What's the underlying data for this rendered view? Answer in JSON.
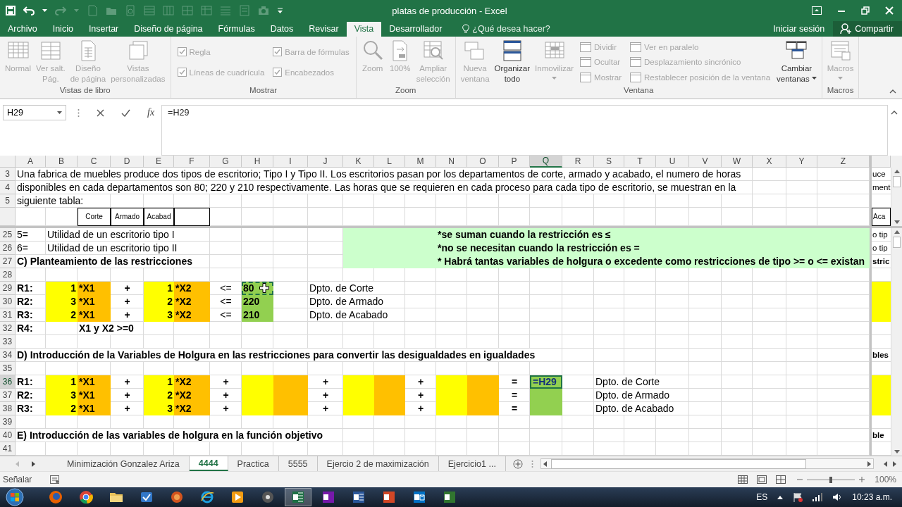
{
  "window": {
    "title": "platas de producción - Excel"
  },
  "ribbon_tabs": [
    {
      "label": "Archivo",
      "selected": false
    },
    {
      "label": "Inicio",
      "selected": false
    },
    {
      "label": "Insertar",
      "selected": false
    },
    {
      "label": "Diseño de página",
      "selected": false
    },
    {
      "label": "Fórmulas",
      "selected": false
    },
    {
      "label": "Datos",
      "selected": false
    },
    {
      "label": "Revisar",
      "selected": false
    },
    {
      "label": "Vista",
      "selected": true
    },
    {
      "label": "Desarrollador",
      "selected": false
    }
  ],
  "tell_me": {
    "placeholder": "¿Qué desea hacer?"
  },
  "account": {
    "sign_in": "Iniciar sesión",
    "share": "Compartir"
  },
  "ribbon_groups": [
    {
      "label": "Vistas de libro",
      "items": [
        {
          "kind": "large",
          "label": "Normal",
          "disabled": true,
          "dropdown": false
        },
        {
          "kind": "large",
          "label": "Ver salt.\nPág.",
          "disabled": true,
          "dropdown": false
        },
        {
          "kind": "large",
          "label": "Diseño\nde página",
          "disabled": true,
          "dropdown": false
        },
        {
          "kind": "large",
          "label": "Vistas\npersonalizadas",
          "disabled": true,
          "dropdown": false
        }
      ]
    },
    {
      "label": "Mostrar",
      "items": [
        {
          "kind": "check",
          "label": "Regla",
          "checked": true,
          "disabled": true
        },
        {
          "kind": "check",
          "label": "Líneas de cuadrícula",
          "checked": true,
          "disabled": true
        },
        {
          "kind": "check",
          "label": "Barra de fórmulas",
          "checked": true,
          "disabled": true
        },
        {
          "kind": "check",
          "label": "Encabezados",
          "checked": true,
          "disabled": true
        }
      ]
    },
    {
      "label": "Zoom",
      "items": [
        {
          "kind": "large",
          "label": "Zoom",
          "disabled": true,
          "dropdown": false
        },
        {
          "kind": "large",
          "label": "100%",
          "disabled": true,
          "dropdown": false
        },
        {
          "kind": "large",
          "label": "Ampliar\nselección",
          "disabled": true,
          "dropdown": false
        }
      ]
    },
    {
      "label": "Ventana",
      "items": [
        {
          "kind": "large",
          "label": "Nueva\nventana",
          "disabled": true,
          "dropdown": false
        },
        {
          "kind": "large",
          "label": "Organizar\ntodo",
          "disabled": false,
          "dropdown": false
        },
        {
          "kind": "large",
          "label": "Inmovilizar",
          "disabled": true,
          "dropdown": true
        },
        {
          "kind": "small",
          "label": "Dividir",
          "disabled": true
        },
        {
          "kind": "small",
          "label": "Ocultar",
          "disabled": true
        },
        {
          "kind": "small",
          "label": "Mostrar",
          "disabled": true
        },
        {
          "kind": "small",
          "label": "Ver en paralelo",
          "disabled": true
        },
        {
          "kind": "small",
          "label": "Desplazamiento sincrónico",
          "disabled": true
        },
        {
          "kind": "small",
          "label": "Restablecer posición de la ventana",
          "disabled": true
        },
        {
          "kind": "large",
          "label": "Cambiar\nventanas",
          "disabled": false,
          "dropdown": true
        }
      ]
    },
    {
      "label": "Macros",
      "items": [
        {
          "kind": "large",
          "label": "Macros",
          "disabled": true,
          "dropdown": true
        }
      ]
    }
  ],
  "formula_bar": {
    "name_box": "H29",
    "function_button": "fx",
    "formula": "=H29"
  },
  "sheet": {
    "columns": [
      {
        "label": "A",
        "selected": false
      },
      {
        "label": "B",
        "selected": false
      },
      {
        "label": "C",
        "selected": false
      },
      {
        "label": "D",
        "selected": false
      },
      {
        "label": "E",
        "selected": false
      },
      {
        "label": "F",
        "selected": false
      },
      {
        "label": "G",
        "selected": false
      },
      {
        "label": "H",
        "selected": false
      },
      {
        "label": "I",
        "selected": false
      },
      {
        "label": "J",
        "selected": false
      },
      {
        "label": "K",
        "selected": false
      },
      {
        "label": "L",
        "selected": false
      },
      {
        "label": "M",
        "selected": false
      },
      {
        "label": "N",
        "selected": false
      },
      {
        "label": "O",
        "selected": false
      },
      {
        "label": "P",
        "selected": false
      },
      {
        "label": "Q",
        "selected": true
      },
      {
        "label": "R",
        "selected": false
      },
      {
        "label": "S",
        "selected": false
      },
      {
        "label": "T",
        "selected": false
      },
      {
        "label": "U",
        "selected": false
      },
      {
        "label": "V",
        "selected": false
      },
      {
        "label": "W",
        "selected": false
      },
      {
        "label": "X",
        "selected": false
      },
      {
        "label": "Y",
        "selected": false
      },
      {
        "label": "Z",
        "selected": false
      }
    ],
    "top_rows": [
      {
        "number": "3",
        "kind": "normal",
        "selected": false,
        "cells": {
          "A": {
            "text": "Una fabrica de muebles produce dos tipos de escritorio; Tipo I y Tipo II. Los escritorios pasan por los departamentos de corte, armado y acabado, el numero de horas"
          },
          "pane": {
            "text": "uce"
          }
        }
      },
      {
        "number": "4",
        "kind": "normal",
        "selected": false,
        "cells": {
          "A": {
            "text": "disponibles en cada departamentos son 80; 220 y 210 respectivamente. Las horas que se requieren en cada proceso para cada tipo de escritorio, se muestran en la"
          },
          "pane": {
            "text": "ment"
          }
        }
      },
      {
        "number": "5",
        "kind": "normal",
        "selected": false,
        "cells": {
          "A": {
            "text": "siguiente tabla:"
          }
        }
      },
      {
        "kind": "small",
        "selected": false,
        "cells": {
          "C": {
            "text": "Corte",
            "centered": true,
            "border": true
          },
          "D": {
            "text": "Armado",
            "centered": true,
            "border": true
          },
          "E": {
            "text": "Acabad",
            "centered": true,
            "border": true
          },
          "F": {
            "border": true
          },
          "pane": {
            "text": "Aca",
            "border": true
          }
        }
      }
    ],
    "bottom_rows": [
      {
        "number": "25",
        "kind": "normal",
        "selected": false,
        "cells": {
          "A": {
            "text": "5="
          },
          "B": {
            "text": "Utilidad de un escritorio tipo I"
          },
          "K": {
            "color": "#ccffcc",
            "fill_to_end": true
          },
          "N": {
            "text": "*se suman cuando la restricción es ≤",
            "bold": true
          },
          "pane": {
            "text": "o tip"
          }
        }
      },
      {
        "number": "26",
        "kind": "normal",
        "selected": false,
        "cells": {
          "A": {
            "text": "6="
          },
          "B": {
            "text": "Utilidad de un escritorio tipo II"
          },
          "K": {
            "color": "#ccffcc",
            "fill_to_end": true
          },
          "N": {
            "text": "*no se necesitan cuando la restricción es =",
            "bold": true
          },
          "pane": {
            "text": "o tip"
          }
        }
      },
      {
        "number": "27",
        "kind": "normal",
        "selected": false,
        "cells": {
          "A": {
            "text": "C) Planteamiento de las restricciones",
            "bold": true
          },
          "K": {
            "color": "#ccffcc",
            "fill_to_end": true
          },
          "N": {
            "text": "* Habrá tantas variables de holgura o excedente como restricciones de tipo >= o <= existan",
            "bold": true
          },
          "pane": {
            "text": "stric",
            "bold": true
          }
        }
      },
      {
        "number": "28",
        "kind": "normal",
        "selected": false
      },
      {
        "number": "29",
        "kind": "normal",
        "selected": false,
        "cells": {
          "A": {
            "text": "R1:",
            "bold": true
          },
          "B": {
            "text": "1",
            "color": "#ffff00",
            "right_aligned": true,
            "bold": true
          },
          "C": {
            "text": "*X1",
            "color": "#ffc000",
            "bold": true
          },
          "D": {
            "text": "+",
            "centered": true,
            "bold": true
          },
          "E": {
            "text": "1",
            "color": "#ffff00",
            "right_aligned": true,
            "bold": true
          },
          "F": {
            "text": "*X2",
            "color": "#ffc000",
            "bold": true
          },
          "G": {
            "text": "<=",
            "centered": true
          },
          "H": {
            "text": "80",
            "color": "#92d050",
            "bold": true,
            "marquee": true,
            "mouse_cursor": true
          },
          "J": {
            "text": "Dpto. de Corte"
          },
          "pane": {
            "color": "#ffff00"
          }
        }
      },
      {
        "number": "30",
        "kind": "normal",
        "selected": false,
        "cells": {
          "A": {
            "text": "R2:",
            "bold": true
          },
          "B": {
            "text": "3",
            "color": "#ffff00",
            "right_aligned": true,
            "bold": true
          },
          "C": {
            "text": "*X1",
            "color": "#ffc000",
            "bold": true
          },
          "D": {
            "text": "+",
            "centered": true,
            "bold": true
          },
          "E": {
            "text": "2",
            "color": "#ffff00",
            "right_aligned": true,
            "bold": true
          },
          "F": {
            "text": "*X2",
            "color": "#ffc000",
            "bold": true
          },
          "G": {
            "text": "<=",
            "centered": true
          },
          "H": {
            "text": "220",
            "color": "#92d050",
            "bold": true
          },
          "J": {
            "text": "Dpto. de Armado"
          },
          "pane": {
            "color": "#ffff00"
          }
        }
      },
      {
        "number": "31",
        "kind": "normal",
        "selected": false,
        "cells": {
          "A": {
            "text": "R3:",
            "bold": true
          },
          "B": {
            "text": "2",
            "color": "#ffff00",
            "right_aligned": true,
            "bold": true
          },
          "C": {
            "text": "*X1",
            "color": "#ffc000",
            "bold": true
          },
          "D": {
            "text": "+",
            "centered": true,
            "bold": true
          },
          "E": {
            "text": "3",
            "color": "#ffff00",
            "right_aligned": true,
            "bold": true
          },
          "F": {
            "text": "*X2",
            "color": "#ffc000",
            "bold": true
          },
          "G": {
            "text": "<=",
            "centered": true
          },
          "H": {
            "text": "210",
            "color": "#92d050",
            "bold": true
          },
          "J": {
            "text": "Dpto. de Acabado"
          },
          "pane": {
            "color": "#ffff00"
          }
        }
      },
      {
        "number": "32",
        "kind": "normal",
        "selected": false,
        "cells": {
          "A": {
            "text": "R4:",
            "bold": true
          },
          "C": {
            "text": "X1 y X2 >=0",
            "bold": true
          }
        }
      },
      {
        "number": "33",
        "kind": "normal",
        "selected": false
      },
      {
        "number": "34",
        "kind": "normal",
        "selected": false,
        "cells": {
          "A": {
            "text": "D) Introducción de la Variables de Holgura en las restricciones  para convertir las desigualdades en igualdades",
            "bold": true
          },
          "pane": {
            "text": "bles",
            "bold": true
          }
        }
      },
      {
        "number": "35",
        "kind": "normal",
        "selected": false
      },
      {
        "number": "36",
        "kind": "normal",
        "selected": true,
        "cells": {
          "A": {
            "text": "R1:",
            "bold": true
          },
          "B": {
            "text": "1",
            "color": "#ffff00",
            "right_aligned": true,
            "bold": true
          },
          "C": {
            "text": "*X1",
            "color": "#ffc000",
            "bold": true
          },
          "D": {
            "text": "+",
            "centered": true,
            "bold": true
          },
          "E": {
            "text": "1",
            "color": "#ffff00",
            "right_aligned": true,
            "bold": true
          },
          "F": {
            "text": "*X2",
            "color": "#ffc000",
            "bold": true
          },
          "G": {
            "text": "+",
            "centered": true,
            "bold": true
          },
          "H": {
            "color": "#ffff00"
          },
          "I": {
            "color": "#ffc000"
          },
          "J": {
            "text": "+",
            "centered": true,
            "bold": true
          },
          "K": {
            "color": "#ffff00"
          },
          "L": {
            "color": "#ffc000"
          },
          "M": {
            "text": "+",
            "centered": true,
            "bold": true
          },
          "N": {
            "color": "#ffff00"
          },
          "O": {
            "color": "#ffc000"
          },
          "P": {
            "text": "=",
            "centered": true,
            "bold": true
          },
          "Q": {
            "text": "=H29",
            "color": "#92d050",
            "bold": true,
            "editing": true
          },
          "S": {
            "text": "Dpto. de Corte"
          },
          "pane": {
            "color": "#ffff00"
          }
        }
      },
      {
        "number": "37",
        "kind": "normal",
        "selected": false,
        "cells": {
          "A": {
            "text": "R2:",
            "bold": true
          },
          "B": {
            "text": "3",
            "color": "#ffff00",
            "right_aligned": true,
            "bold": true
          },
          "C": {
            "text": "*X1",
            "color": "#ffc000",
            "bold": true
          },
          "D": {
            "text": "+",
            "centered": true,
            "bold": true
          },
          "E": {
            "text": "2",
            "color": "#ffff00",
            "right_aligned": true,
            "bold": true
          },
          "F": {
            "text": "*X2",
            "color": "#ffc000",
            "bold": true
          },
          "G": {
            "text": "+",
            "centered": true,
            "bold": true
          },
          "H": {
            "color": "#ffff00"
          },
          "I": {
            "color": "#ffc000"
          },
          "J": {
            "text": "+",
            "centered": true,
            "bold": true
          },
          "K": {
            "color": "#ffff00"
          },
          "L": {
            "color": "#ffc000"
          },
          "M": {
            "text": "+",
            "centered": true,
            "bold": true
          },
          "N": {
            "color": "#ffff00"
          },
          "O": {
            "color": "#ffc000"
          },
          "P": {
            "text": "=",
            "centered": true,
            "bold": true
          },
          "Q": {
            "color": "#92d050"
          },
          "S": {
            "text": "Dpto. de Armado"
          },
          "pane": {
            "color": "#ffff00"
          }
        }
      },
      {
        "number": "38",
        "kind": "normal",
        "selected": false,
        "cells": {
          "A": {
            "text": "R3:",
            "bold": true
          },
          "B": {
            "text": "2",
            "color": "#ffff00",
            "right_aligned": true,
            "bold": true
          },
          "C": {
            "text": "*X1",
            "color": "#ffc000",
            "bold": true
          },
          "D": {
            "text": "+",
            "centered": true,
            "bold": true
          },
          "E": {
            "text": "3",
            "color": "#ffff00",
            "right_aligned": true,
            "bold": true
          },
          "F": {
            "text": "*X2",
            "color": "#ffc000",
            "bold": true
          },
          "G": {
            "text": "+",
            "centered": true,
            "bold": true
          },
          "H": {
            "color": "#ffff00"
          },
          "I": {
            "color": "#ffc000"
          },
          "J": {
            "text": "+",
            "centered": true,
            "bold": true
          },
          "K": {
            "color": "#ffff00"
          },
          "L": {
            "color": "#ffc000"
          },
          "M": {
            "text": "+",
            "centered": true,
            "bold": true
          },
          "N": {
            "color": "#ffff00"
          },
          "O": {
            "color": "#ffc000"
          },
          "P": {
            "text": "=",
            "centered": true,
            "bold": true
          },
          "Q": {
            "color": "#92d050"
          },
          "S": {
            "text": "Dpto. de Acabado"
          },
          "pane": {
            "color": "#ffff00"
          }
        }
      },
      {
        "number": "39",
        "kind": "normal",
        "selected": false
      },
      {
        "number": "40",
        "kind": "normal",
        "selected": false,
        "cells": {
          "A": {
            "text": "E) Introducción de las variables de holgura en la función objetivo",
            "bold": true
          },
          "pane": {
            "text": "ble",
            "bold": true
          }
        }
      },
      {
        "number": "41",
        "kind": "normal",
        "selected": false
      }
    ]
  },
  "sheet_tabs": [
    {
      "label": "Minimización Gonzalez Ariza",
      "selected": false
    },
    {
      "label": "4444",
      "selected": true
    },
    {
      "label": "Practica",
      "selected": false
    },
    {
      "label": "5555",
      "selected": false
    },
    {
      "label": "Ejercio 2 de maximización",
      "selected": false
    },
    {
      "label": "Ejercicio1 ...",
      "selected": false
    }
  ],
  "status_bar": {
    "mode": "Señalar",
    "zoom": {
      "level": 0.5,
      "reading": "100%"
    }
  },
  "taskbar": {
    "apps": [
      {
        "kind": "firefox",
        "active": false
      },
      {
        "kind": "chrome",
        "active": false
      },
      {
        "kind": "folder",
        "active": false
      },
      {
        "kind": "check",
        "active": false
      },
      {
        "kind": "round",
        "active": false
      },
      {
        "kind": "ie",
        "active": false
      },
      {
        "kind": "media",
        "active": false
      },
      {
        "kind": "disc",
        "active": false
      },
      {
        "kind": "sheet",
        "active": true
      },
      {
        "kind": "note",
        "active": false
      },
      {
        "kind": "doc",
        "active": false
      },
      {
        "kind": "slides",
        "active": false
      },
      {
        "kind": "mail",
        "active": false
      },
      {
        "kind": "project",
        "active": false
      }
    ],
    "language": "ES",
    "clock": "10:23 a.m."
  }
}
